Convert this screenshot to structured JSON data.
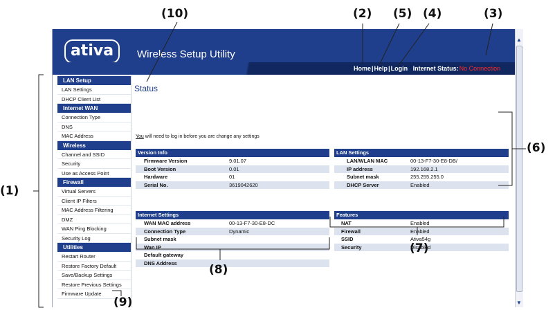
{
  "app": {
    "logo": "ativa",
    "title": "Wireless Setup Utility"
  },
  "nav": {
    "home": "Home",
    "help": "Help",
    "login": "Login",
    "status_label": "Internet Status:",
    "status_value": "No Connection"
  },
  "colors": {
    "brand": "#1f3f8c",
    "status_red": "#ff2a2a"
  },
  "sidebar": [
    {
      "header": "LAN Setup",
      "items": [
        "LAN Settings",
        "DHCP Client List"
      ]
    },
    {
      "header": "Internet WAN",
      "items": [
        "Connection Type",
        "DNS",
        "MAC Address"
      ]
    },
    {
      "header": "Wireless",
      "items": [
        "Channel and SSID",
        "Security",
        "Use as Access Point"
      ]
    },
    {
      "header": "Firewall",
      "items": [
        "Virtual Servers",
        "Client IP Filters",
        "MAC Address Filtering",
        "DMZ",
        "WAN Ping Blocking",
        "Security Log"
      ]
    },
    {
      "header": "Utilities",
      "items": [
        "Restart Router",
        "Restore Factory Default",
        "Save/Backup Settings",
        "Restore Previous Settings",
        "Firmware Update"
      ]
    }
  ],
  "main": {
    "title": "Status",
    "hint_link": "You",
    "hint_rest": " will need to log in before you are change any settings",
    "version": {
      "title": "Version Info",
      "rows": [
        [
          "Firmware Version",
          "9.01.07"
        ],
        [
          "Boot Version",
          "0.01"
        ],
        [
          "Hardware",
          "01"
        ],
        [
          "Serial No.",
          "3619042620"
        ]
      ]
    },
    "lan": {
      "title": "LAN Settings",
      "rows": [
        [
          "LAN/WLAN MAC",
          "00-13-F7-30-E8-DB/"
        ],
        [
          "IP address",
          "192.168.2.1"
        ],
        [
          "Subnet mask",
          "255.255.255.0"
        ],
        [
          "DHCP Server",
          "Enabled"
        ]
      ]
    },
    "internet": {
      "title": "Internet Settings",
      "rows": [
        [
          "WAN MAC address",
          "00-13-F7-30-E8-DC"
        ],
        [
          "Connection Type",
          "Dynamic"
        ],
        [
          "Subnet mask",
          ""
        ],
        [
          "Wan IP",
          ""
        ],
        [
          "Default gateway",
          ""
        ],
        [
          "DNS Address",
          ""
        ]
      ]
    },
    "features": {
      "title": "Features",
      "rows": [
        [
          "NAT",
          "Enabled"
        ],
        [
          "Firewall",
          "Enabled"
        ],
        [
          "SSID",
          "Ativa54g"
        ],
        [
          "Security",
          "Disabled"
        ]
      ]
    }
  },
  "callouts": [
    "(1)",
    "(2)",
    "(3)",
    "(4)",
    "(5)",
    "(6)",
    "(7)",
    "(8)",
    "(9)",
    "(10)"
  ]
}
